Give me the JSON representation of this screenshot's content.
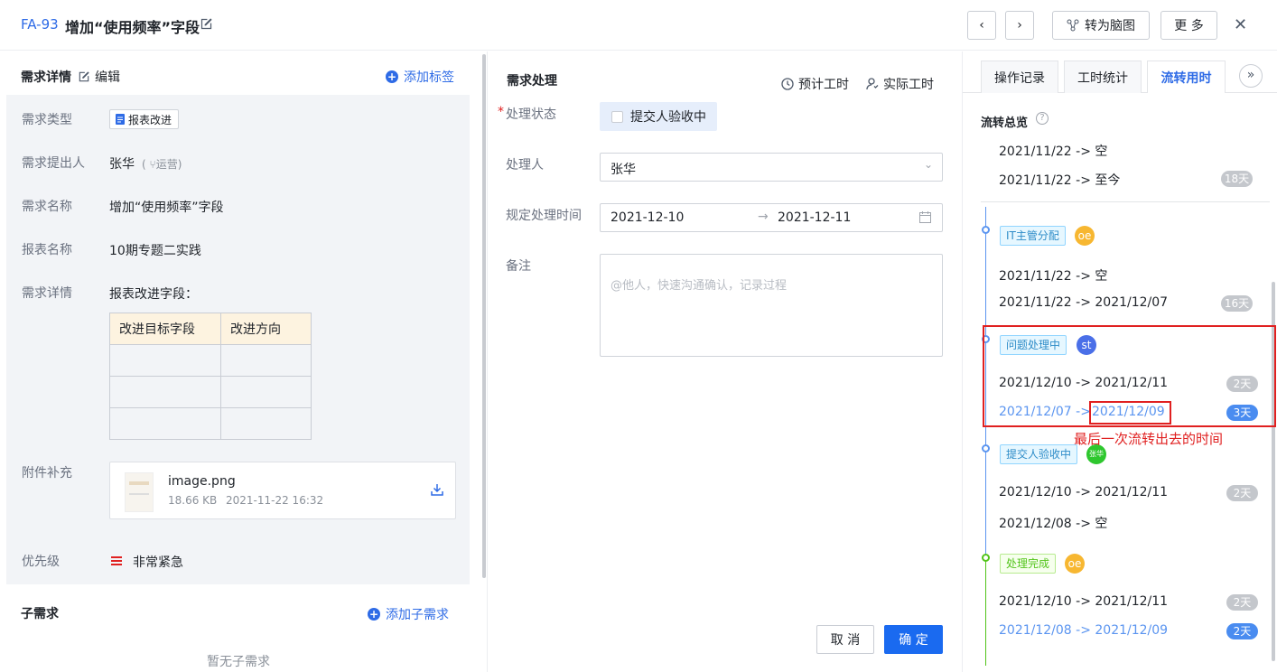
{
  "header": {
    "id": "FA-93",
    "title": "增加“使用频率”字段",
    "mindmap_label": "转为脑图",
    "more_label": "更 多"
  },
  "left": {
    "section_title": "需求详情",
    "edit_label": "编辑",
    "add_tag_label": "添加标签",
    "fields": {
      "type_label": "需求类型",
      "type_value": "报表改进",
      "proposer_label": "需求提出人",
      "proposer_value": "张华",
      "proposer_dept": "运营",
      "name_label": "需求名称",
      "name_value": "增加“使用频率”字段",
      "report_label": "报表名称",
      "report_value": "10期专题二实践",
      "detail_label": "需求详情",
      "detail_value": "报表改进字段：",
      "attach_label": "附件补充",
      "priority_label": "优先级",
      "priority_value": "非常紧急"
    },
    "table": {
      "headers": [
        "改进目标字段",
        "改进方向"
      ],
      "rows": 3
    },
    "attachment": {
      "name": "image.png",
      "size": "18.66 KB",
      "time": "2021-11-22 16:32"
    },
    "sub": {
      "title": "子需求",
      "add_label": "添加子需求",
      "empty_label": "暂无子需求"
    }
  },
  "middle": {
    "title": "需求处理",
    "est_hours_label": "预计工时",
    "act_hours_label": "实际工时",
    "status_label": "处理状态",
    "status_value": "提交人验收中",
    "handler_label": "处理人",
    "handler_value": "张华",
    "time_label": "规定处理时间",
    "time_start": "2021-12-10",
    "time_end": "2021-12-11",
    "note_label": "备注",
    "note_placeholder": "@他人，快速沟通确认，记录过程",
    "cancel_label": "取 消",
    "confirm_label": "确 定"
  },
  "right": {
    "tabs": [
      "操作记录",
      "工时统计",
      "流转用时"
    ],
    "overview_title": "流转总览",
    "top_rows": [
      {
        "text": "2021/11/22 -> 空"
      },
      {
        "text": "2021/11/22 -> 至今",
        "days": "18天"
      }
    ],
    "stages": [
      {
        "tag": "IT主管分配",
        "avatar": "oe",
        "row1": "2021/11/22 -> 空",
        "row2": "2021/11/22 -> 2021/12/07",
        "days2": "16天"
      },
      {
        "tag": "问题处理中",
        "avatar": "st",
        "row1": "2021/12/10 -> 2021/12/11",
        "days1": "2天",
        "row2_a": "2021/12/07 -> ",
        "row2_b": "2021/12/09",
        "days2": "3天"
      },
      {
        "tag": "提交人验收中",
        "avatar": "张华",
        "row1": "2021/12/10 -> 2021/12/11",
        "days1": "2天",
        "row2": "2021/12/08 -> 空"
      },
      {
        "tag": "处理完成",
        "avatar": "oe",
        "row1": "2021/12/10 -> 2021/12/11",
        "days1": "2天",
        "row2": "2021/12/08 -> 2021/12/09",
        "days2": "2天"
      }
    ],
    "annotation": "最后一次流转出去的时间"
  },
  "colors": {
    "accent": "#2e6be6",
    "annotation_red": "#e02020"
  }
}
